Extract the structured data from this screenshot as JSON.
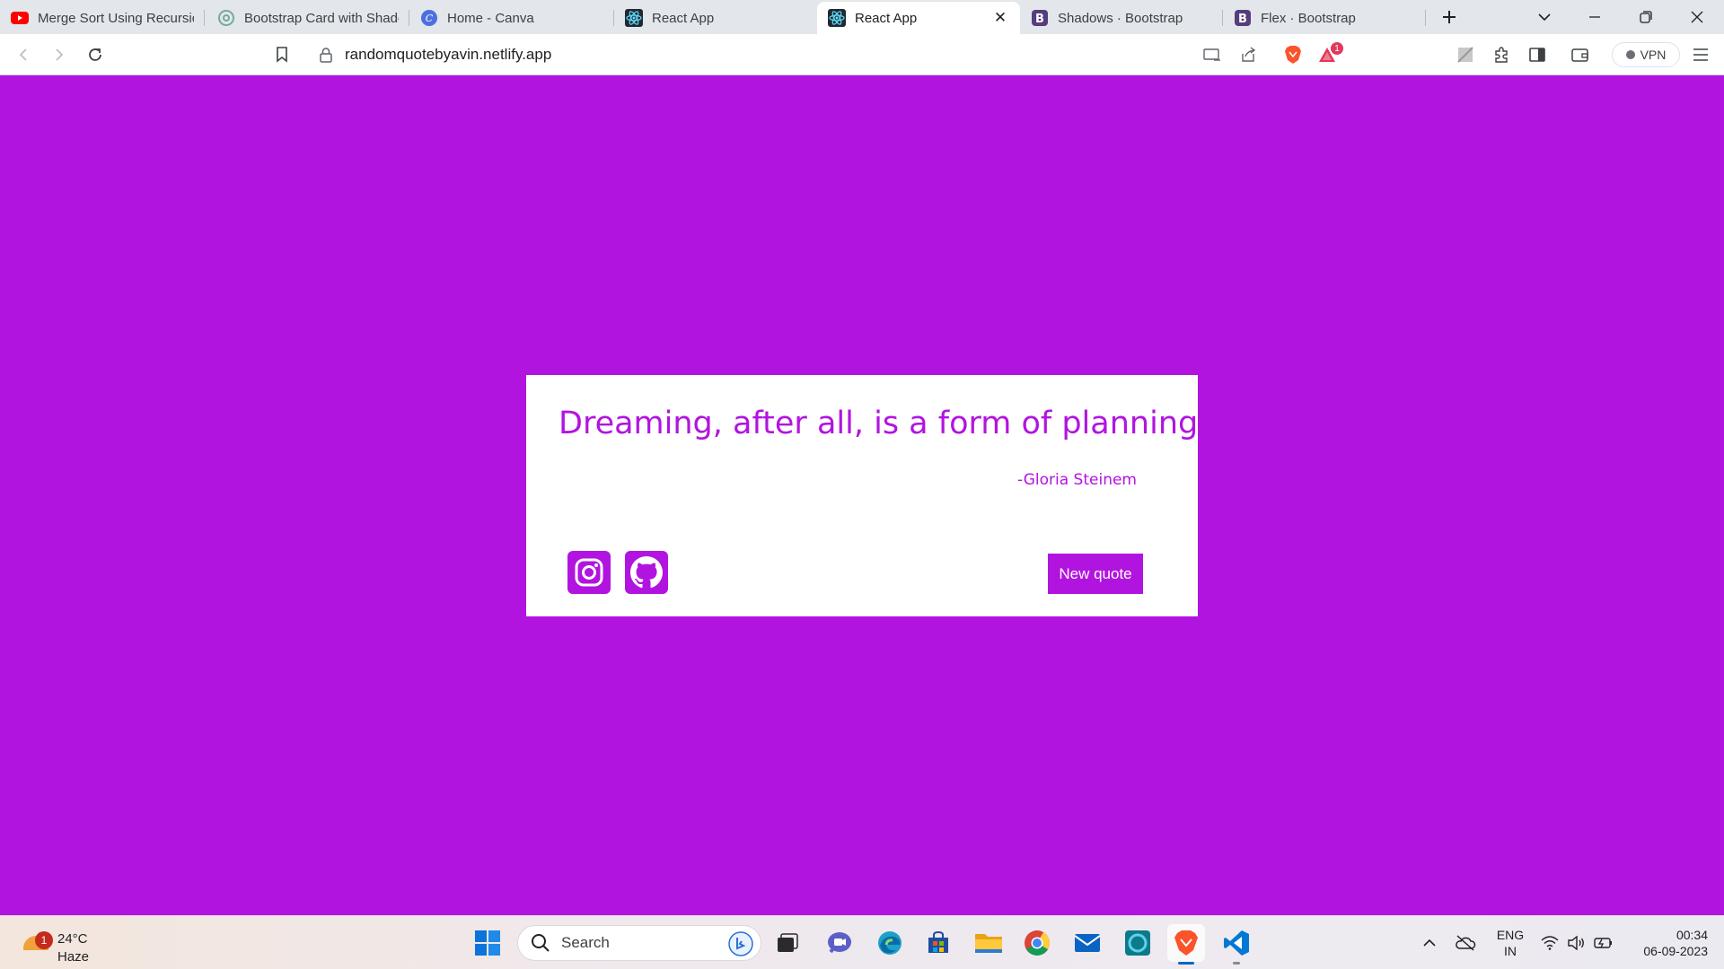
{
  "browser": {
    "tabs": [
      {
        "title": "Merge Sort Using Recursion",
        "favicon": "youtube-icon"
      },
      {
        "title": "Bootstrap Card with Shadow",
        "favicon": "chatgpt-icon"
      },
      {
        "title": "Home - Canva",
        "favicon": "canva-icon"
      },
      {
        "title": "React App",
        "favicon": "react-icon"
      },
      {
        "title": "React App",
        "favicon": "react-icon",
        "active": true
      },
      {
        "title": "Shadows · Bootstrap",
        "favicon": "bootstrap-icon"
      },
      {
        "title": "Flex · Bootstrap",
        "favicon": "bootstrap-icon"
      }
    ],
    "url": "randomquotebyavin.netlify.app",
    "vpn_label": "VPN",
    "brave_rewards_count": "1"
  },
  "page": {
    "quote": "Dreaming, after all, is a form of planning.",
    "author": "-Gloria Steinem",
    "new_quote_label": "New quote",
    "social": [
      "instagram-icon",
      "github-icon"
    ],
    "accent_color": "#b214e0",
    "card_color": "#ffffff"
  },
  "taskbar": {
    "weather": {
      "temp": "24°C",
      "condition": "Haze",
      "alert_count": "1"
    },
    "search_placeholder": "Search",
    "apps": [
      "start-icon",
      "task-view-icon",
      "teams-chat-icon",
      "edge-icon",
      "store-icon",
      "file-explorer-icon",
      "chrome-icon",
      "mail-icon",
      "alexa-icon",
      "brave-icon",
      "vscode-icon"
    ],
    "language": {
      "line1": "ENG",
      "line2": "IN"
    },
    "time": "00:34",
    "date": "06-09-2023"
  }
}
